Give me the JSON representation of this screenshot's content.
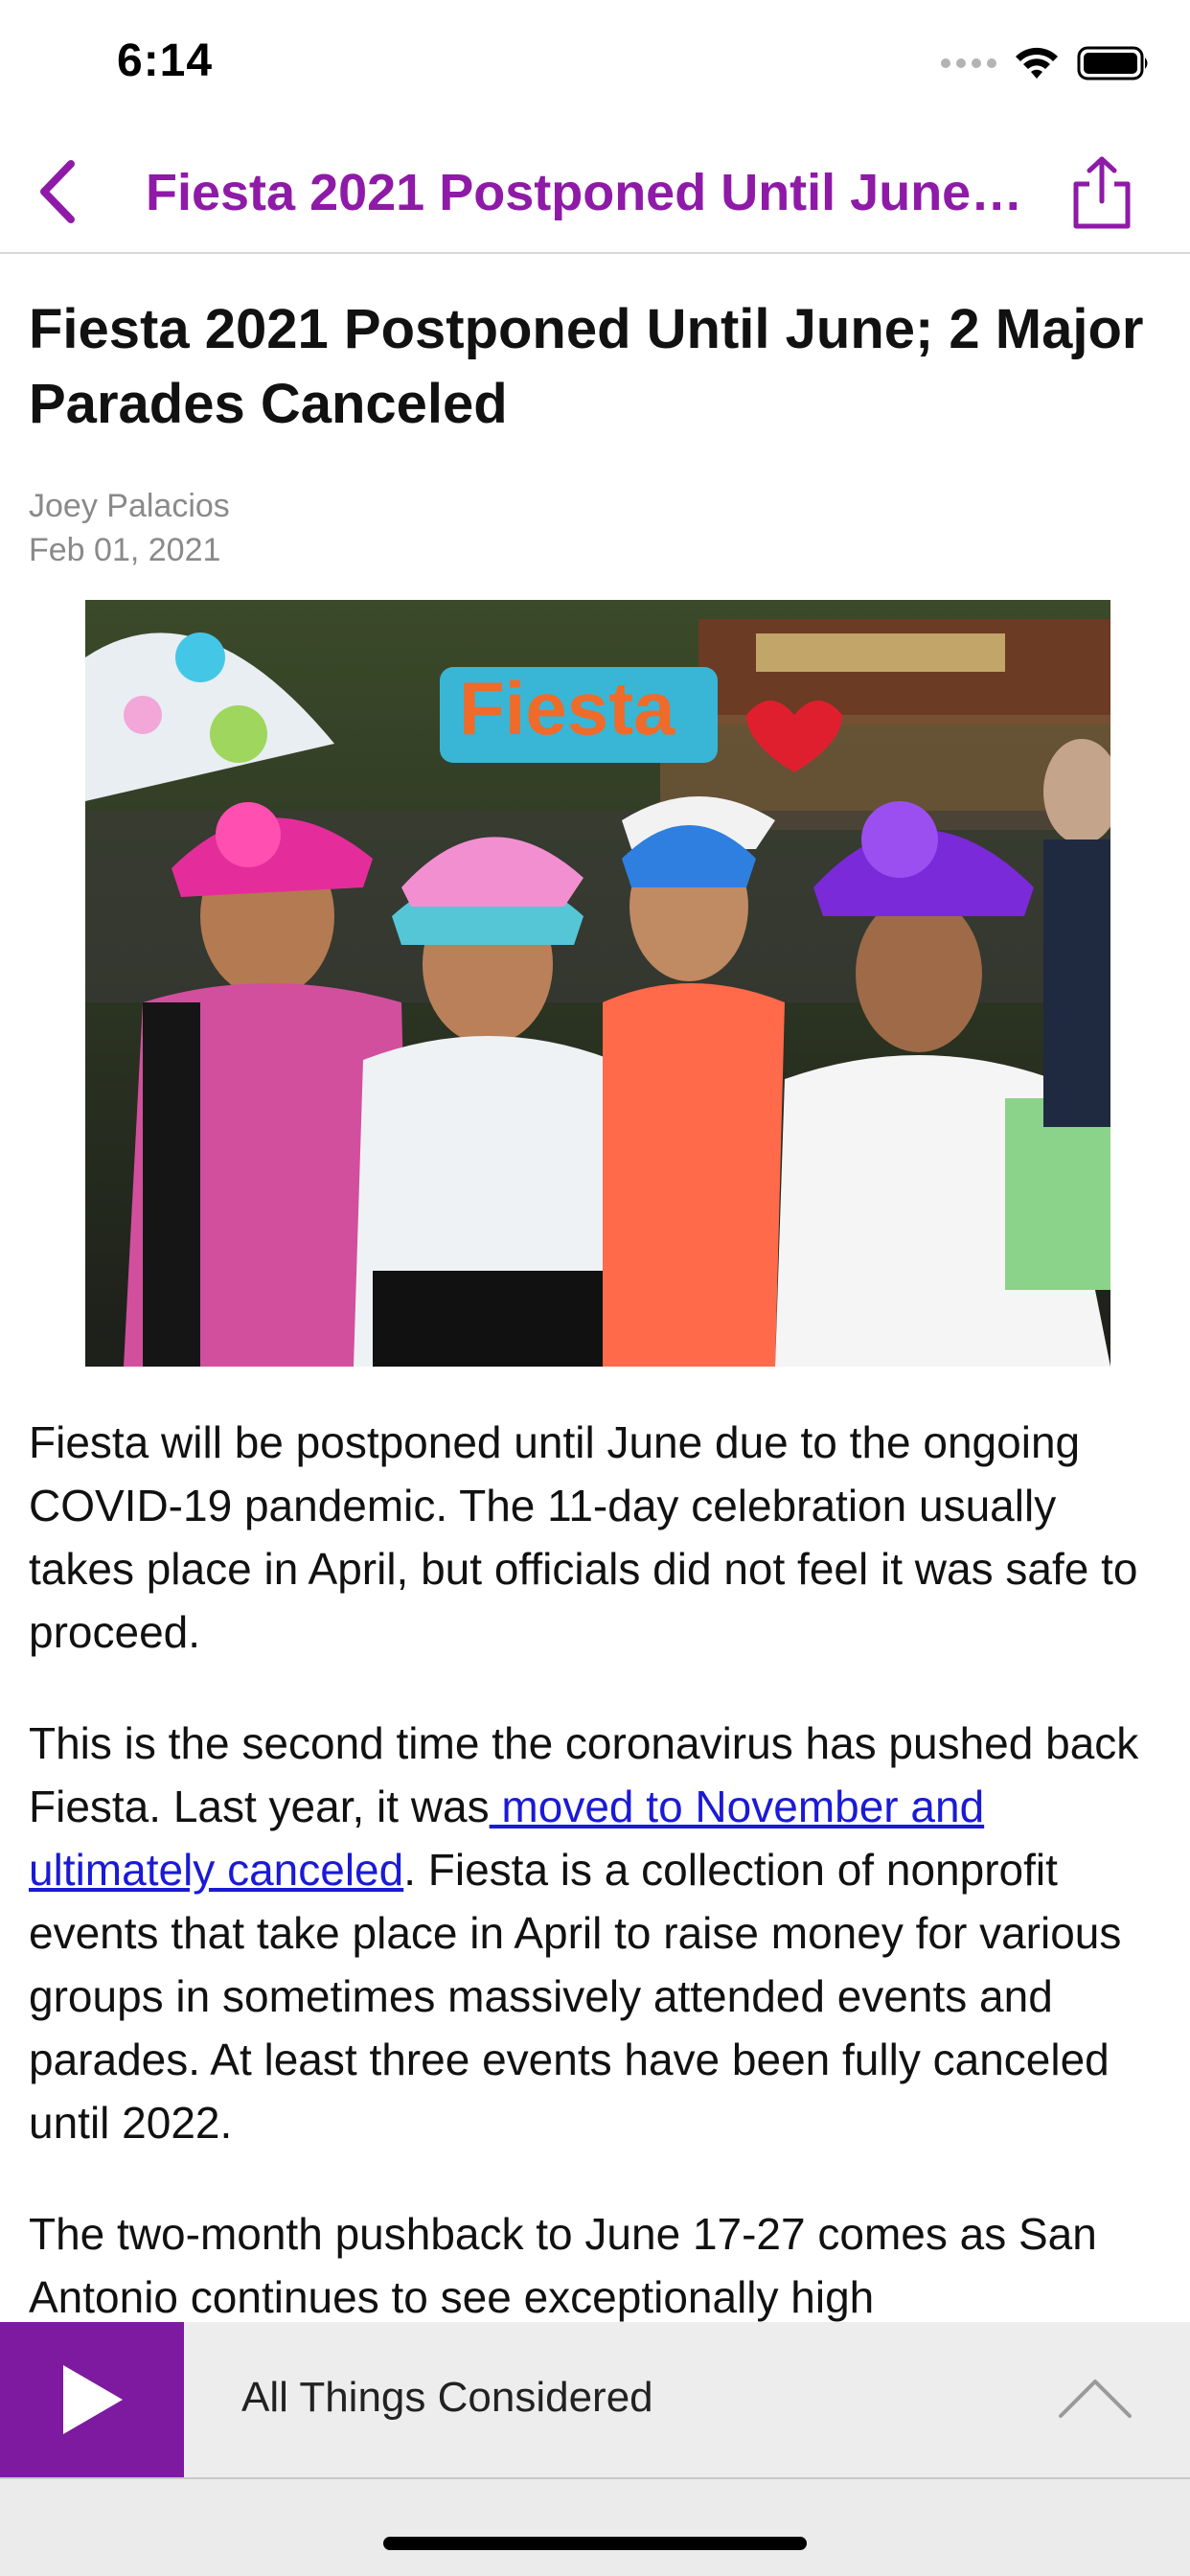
{
  "status_bar": {
    "time": "6:14",
    "icons": [
      "signal-dots-icon",
      "wifi-icon",
      "battery-icon"
    ]
  },
  "nav": {
    "back_icon": "chevron-left-icon",
    "title": "Fiesta 2021 Postponed Until June; 2 Major Parades Canceled",
    "share_icon": "share-icon",
    "accent_color": "#8e1aa7"
  },
  "article": {
    "headline": "Fiesta 2021 Postponed Until June; 2 Major Parades Canceled",
    "author": "Joey Palacios",
    "date": "Feb 01, 2021",
    "paragraph1": "Fiesta will be postponed until June due to the ongoing COVID-19 pandemic. The 11-day celebration usually takes place in April, but officials did not feel it was safe to proceed.",
    "paragraph2_before": "This is the second time the coronavirus has pushed back Fiesta. Last year, it was",
    "paragraph2_link": " moved to November and ultimately canceled",
    "paragraph2_after": ". Fiesta is a collection of nonprofit events that take place in April to raise money for various groups in sometimes massively attended events and parades. At least three events have been fully canceled until 2022.",
    "paragraph3": "The two-month pushback to June 17-27 comes as San Antonio continues to see exceptionally high",
    "link_color": "#1a1ad6",
    "hero_image_sign_text": "Fiesta"
  },
  "player": {
    "play_icon": "play-icon",
    "title": "All Things Considered",
    "expand_icon": "chevron-up-icon",
    "play_bg_color": "#7d1aa0"
  }
}
